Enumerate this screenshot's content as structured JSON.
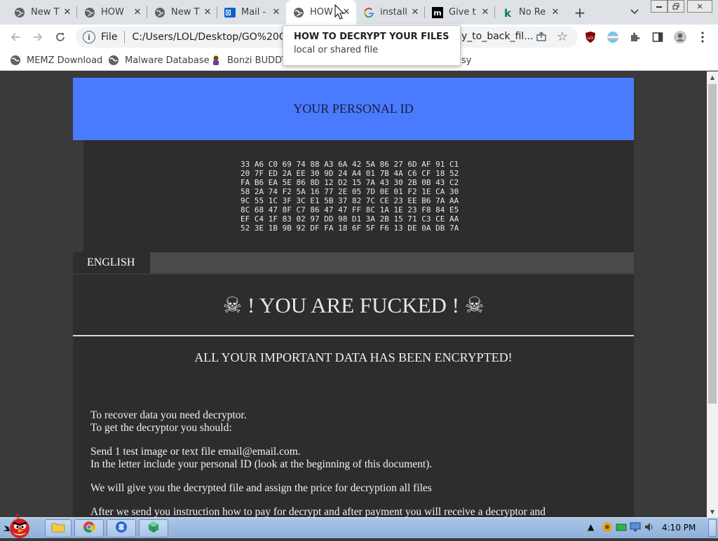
{
  "tabs": [
    {
      "title": "New T",
      "icon": "globe-icon"
    },
    {
      "title": "HOW",
      "icon": "globe-icon"
    },
    {
      "title": "New T",
      "icon": "globe-icon"
    },
    {
      "title": "Mail -",
      "icon": "outlook-icon"
    },
    {
      "title": "HOW",
      "icon": "globe-icon",
      "active": true
    },
    {
      "title": "install",
      "icon": "google-icon"
    },
    {
      "title": "Give t",
      "icon": "medium-icon"
    },
    {
      "title": "No Re",
      "icon": "k-icon"
    }
  ],
  "newtab_label": "+",
  "omnibox": {
    "scheme_label": "File",
    "url": "C:/Users/LOL/Desktop/GO%20GO",
    "url_tail": "y_to_back_fil..."
  },
  "bookmarks": [
    {
      "label": "MEMZ Download",
      "icon": "globe-icon"
    },
    {
      "label": "Malware Database",
      "icon": "globe-icon"
    },
    {
      "label": "Bonzi BUDDY",
      "icon": "bonzi-icon"
    },
    {
      "label": "sy",
      "icon": ""
    }
  ],
  "tooltip": {
    "title": "HOW TO DECRYPT YOUR FILES",
    "subtitle": "local or shared file"
  },
  "page": {
    "id_header": "YOUR PERSONAL ID",
    "personal_id": "33 A6 C0 69 74 88 A3 6A 42 5A 86 27 6D AF 91 C1\n20 7F ED 2A EE 30 9D 24 A4 01 7B 4A C6 CF 18 52\nFA B6 EA 5E 86 8D 12 D2 15 7A 43 30 2B 0B 43 C2\n58 2A 74 F2 5A 16 77 2E 05 7D 0E 01 F2 1E CA 30\n9C 55 1C 3F 3C E1 5B 37 82 7C CE 23 EE B6 7A AA\n8C 68 47 8F C7 86 47 47 FF 8C 1A 1E 23 F8 84 E5\nEF C4 1F 83 02 97 DD 98 D1 3A 2B 15 71 C3 CE AA\n52 3E 1B 9B 92 DF FA 18 6F 5F F6 13 DE 0A DB 7A",
    "language_tab": "ENGLISH",
    "headline": "☠ ! YOU ARE FUCKED ! ☠",
    "subheadline": "ALL YOUR IMPORTANT DATA HAS BEEN ENCRYPTED!",
    "paragraphs": [
      "To recover data you need decryptor.",
      "To get the decryptor you should:",
      "Send 1 test image or text file email@email.com.",
      "In the letter include your personal ID (look at the beginning of this document).",
      "We will give you the decrypted file and assign the price for decryption all files",
      "After we send you instruction how to pay for decrypt and after payment you will receive a decryptor and"
    ]
  },
  "taskbar": {
    "clock": "4:10 PM"
  },
  "colors": {
    "banner": "#4a7bff",
    "panel": "#2d2d2d",
    "page_bg": "#3a3a3a"
  }
}
